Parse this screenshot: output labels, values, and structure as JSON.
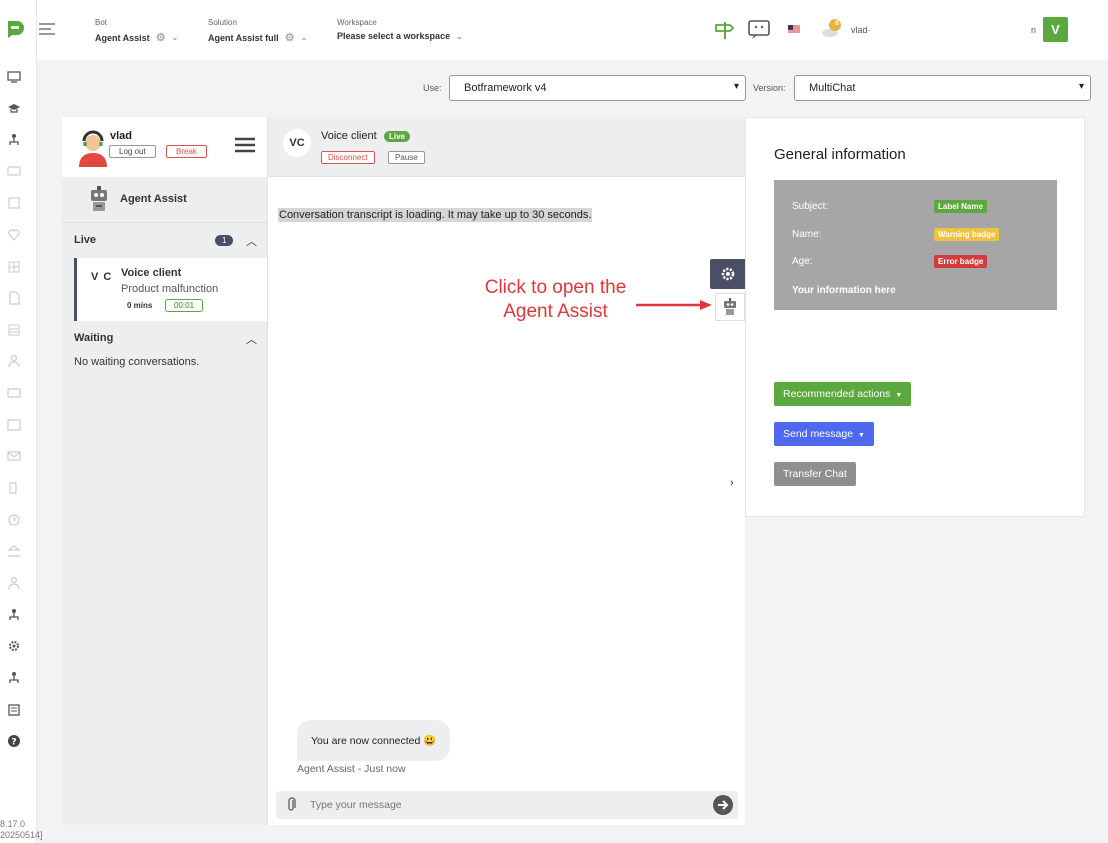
{
  "topbar": {
    "bot": {
      "caption": "Bot",
      "value": "Agent Assist"
    },
    "solution": {
      "caption": "Solution",
      "value": "Agent Assist full"
    },
    "workspace": {
      "caption": "Workspace",
      "value": "Please select a workspace"
    },
    "user_name": "vlad·",
    "user_initial_small": "n",
    "avatar_letter": "V",
    "coin_value": "0"
  },
  "version_info": {
    "line1": "8.17.0",
    "line2": "20250514]"
  },
  "config": {
    "use_label": "Use:",
    "use_value": "Botframework v4",
    "version_label": "Version:",
    "version_value": "MultiChat"
  },
  "agent": {
    "name": "vlad",
    "logout_label": "Log out",
    "break_label": "Break",
    "assist_label": "Agent Assist"
  },
  "queue": {
    "live_label": "Live",
    "live_count": "1",
    "waiting_label": "Waiting",
    "no_waiting_text": "No waiting conversations.",
    "items": [
      {
        "initials": "V C",
        "name": "Voice client",
        "reason": "Product malfunction",
        "mins": "0 mins",
        "timer": "00:01"
      }
    ]
  },
  "chat": {
    "initials": "VC",
    "name": "Voice client",
    "live_badge": "Live",
    "disconnect_label": "Disconnect",
    "pause_label": "Pause",
    "loading_text": "Conversation transcript is loading. It may take up to 30 seconds.",
    "annotation": "Click to open the Agent Assist",
    "message_text": "You are now connected 😃",
    "message_meta": "Agent Assist - Just now",
    "input_placeholder": "Type your message"
  },
  "info": {
    "title": "General information",
    "rows": [
      {
        "label": "Subject:",
        "badge": "Label Name",
        "color": "#5aa83e",
        "text_color": "#ffffff"
      },
      {
        "label": "Name:",
        "badge": "Warning badge",
        "color": "#f0c33c",
        "text_color": "#ffffff"
      },
      {
        "label": "Age:",
        "badge": "Error badge",
        "color": "#d23c3c",
        "text_color": "#ffffff"
      }
    ],
    "more_text": "Your information here",
    "recommended_label": "Recommended actions",
    "send_message_label": "Send message",
    "transfer_label": "Transfer Chat"
  },
  "colors": {
    "brand_green": "#5aa83e",
    "dark_slate": "#4a4f66",
    "send_blue": "#4f68f0",
    "transfer_gray": "#8f8f8f",
    "annotation_red": "#e0383a"
  }
}
